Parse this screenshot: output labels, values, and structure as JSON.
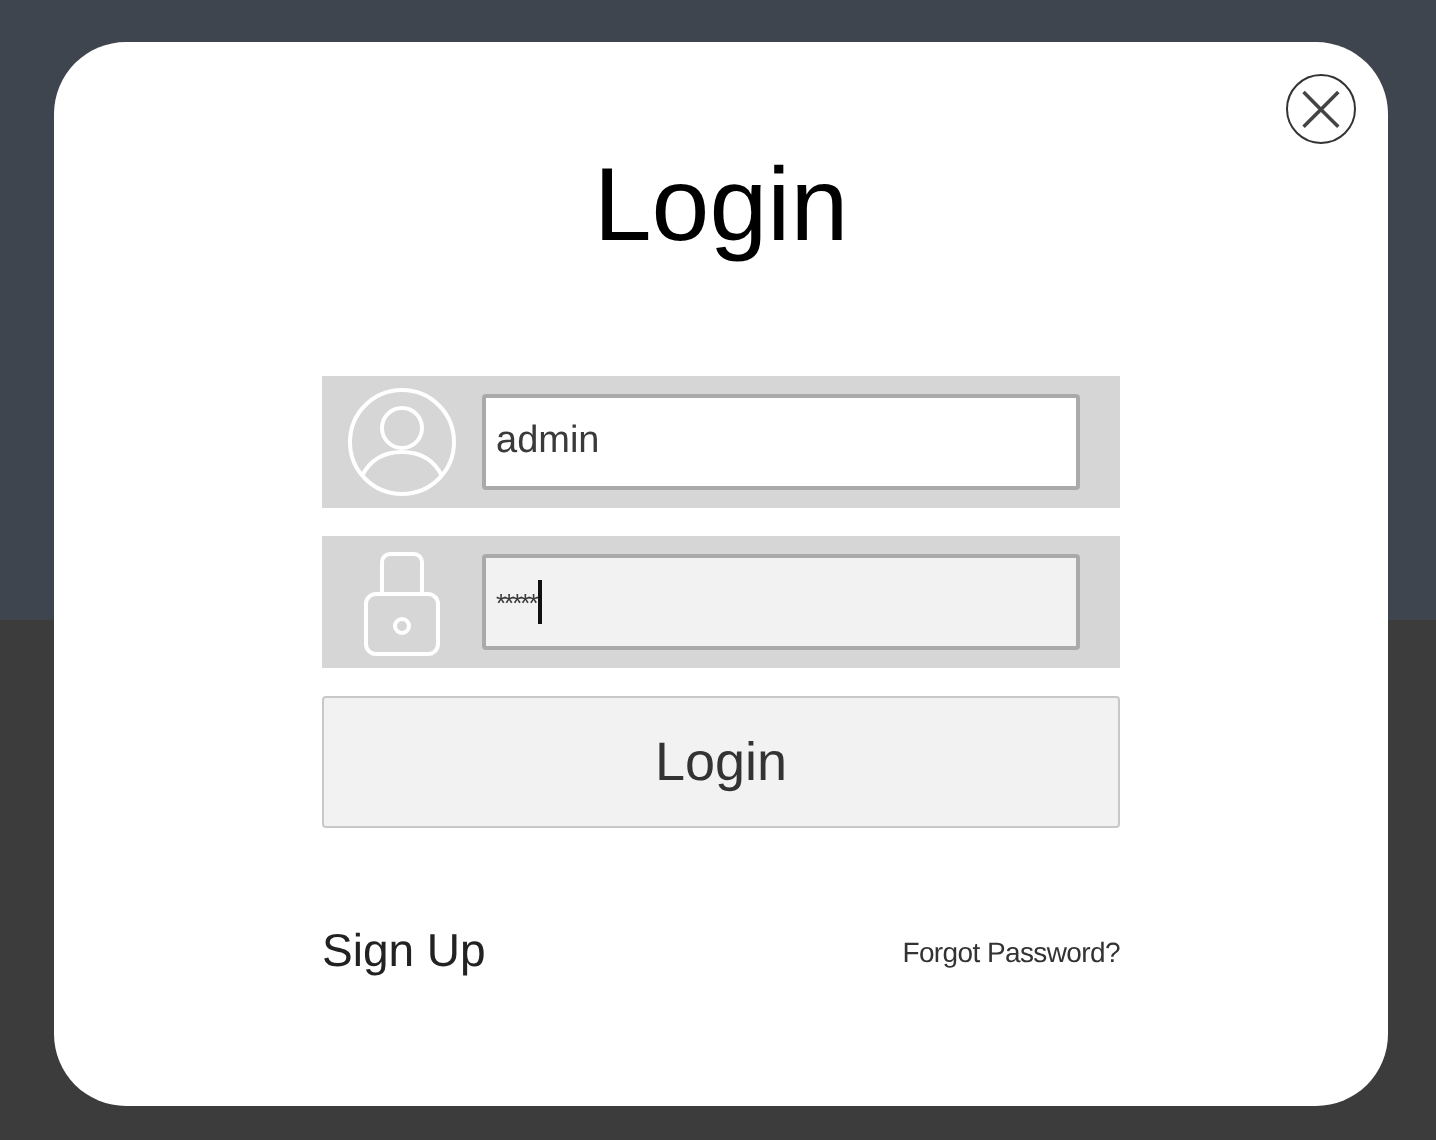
{
  "dialog": {
    "title": "Login",
    "close_label": "×"
  },
  "fields": [
    {
      "kind": "user",
      "value": "admin",
      "focused": false
    },
    {
      "kind": "password",
      "value": "*****",
      "focused": true
    }
  ],
  "login_button": "Login",
  "sign_up": "Sign Up",
  "forgot_password": "Forgot Password?"
}
